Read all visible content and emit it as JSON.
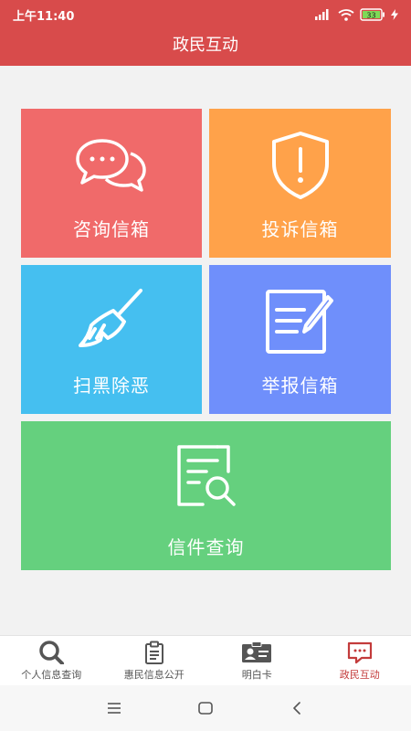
{
  "status_bar": {
    "time": "上午11:40",
    "battery": "33",
    "network": "4G"
  },
  "header": {
    "title": "政民互动"
  },
  "tiles": [
    {
      "label": "咨询信箱",
      "icon": "chat-bubbles-icon",
      "color": "#f06a6a"
    },
    {
      "label": "投诉信箱",
      "icon": "shield-alert-icon",
      "color": "#ffa24a"
    },
    {
      "label": "扫黑除恶",
      "icon": "broom-icon",
      "color": "#45bff0"
    },
    {
      "label": "举报信箱",
      "icon": "document-edit-icon",
      "color": "#6f8ffb"
    },
    {
      "label": "信件查询",
      "icon": "document-search-icon",
      "color": "#65d07e"
    }
  ],
  "bottom_nav": {
    "items": [
      {
        "label": "个人信息查询",
        "icon": "search-icon",
        "active": false
      },
      {
        "label": "惠民信息公开",
        "icon": "clipboard-icon",
        "active": false
      },
      {
        "label": "明白卡",
        "icon": "id-card-icon",
        "active": false
      },
      {
        "label": "政民互动",
        "icon": "message-icon",
        "active": true
      }
    ]
  },
  "colors": {
    "header": "#d84b4b",
    "active_nav": "#c33b3b"
  }
}
